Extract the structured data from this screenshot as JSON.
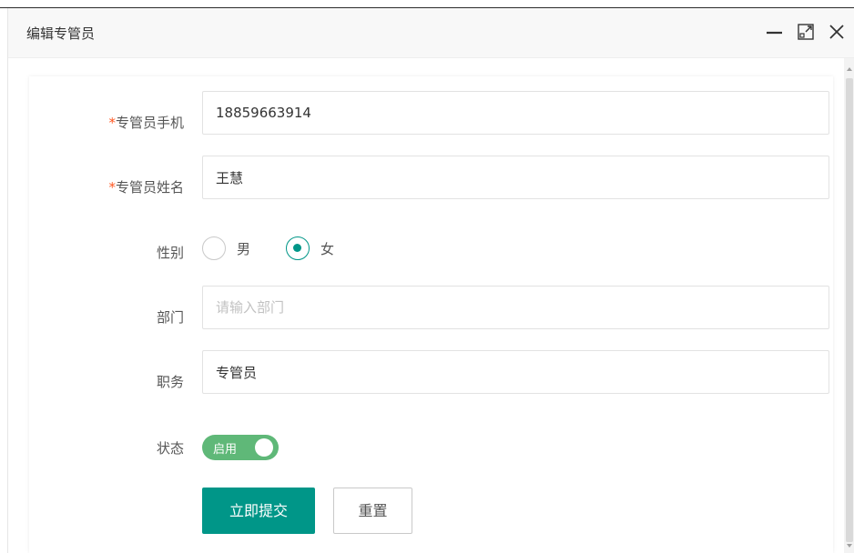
{
  "dialog": {
    "title": "编辑专管员",
    "controls": [
      "minimize-icon",
      "maximize-icon",
      "close-icon"
    ]
  },
  "form": {
    "phone": {
      "required_mark": "*",
      "label": "专管员手机",
      "value": "18859663914"
    },
    "name": {
      "required_mark": "*",
      "label": "专管员姓名",
      "value": "王慧"
    },
    "gender": {
      "label": "性别",
      "options": [
        {
          "label": "男",
          "checked": false
        },
        {
          "label": "女",
          "checked": true
        }
      ]
    },
    "department": {
      "label": "部门",
      "value": "",
      "placeholder": "请输入部门"
    },
    "position": {
      "label": "职务",
      "value": "专管员"
    },
    "status": {
      "label": "状态",
      "switch_text": "启用",
      "on": true
    },
    "submit_label": "立即提交",
    "reset_label": "重置"
  },
  "colors": {
    "primary": "#009688",
    "switch_on": "#5fb878",
    "required": "#ff5722"
  }
}
